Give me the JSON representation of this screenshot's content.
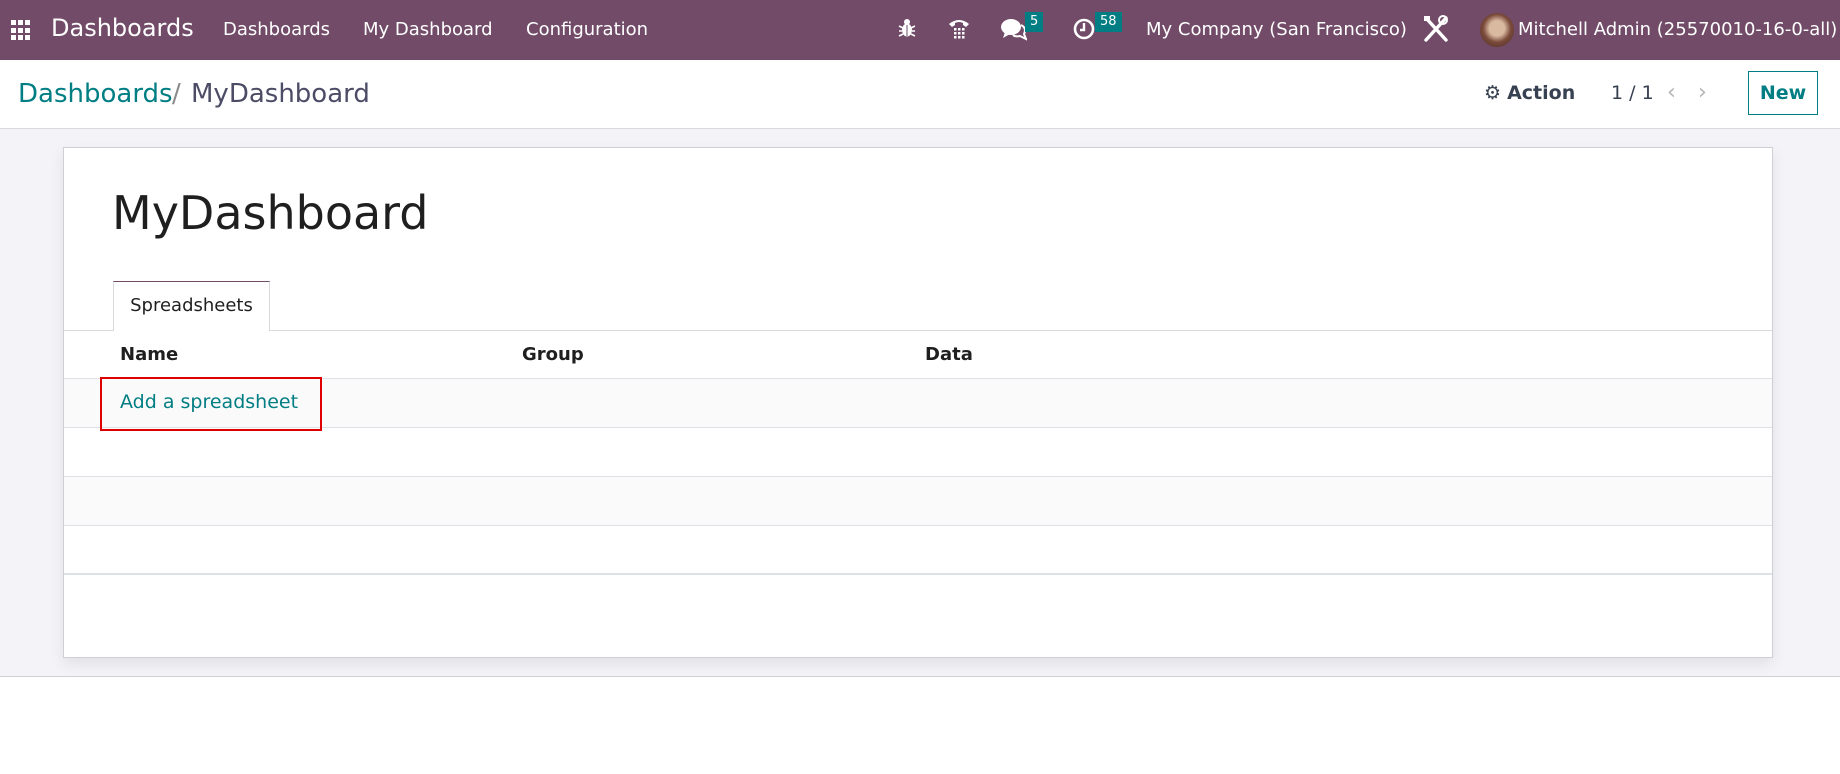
{
  "navbar": {
    "app_name": "Dashboards",
    "menu": [
      "Dashboards",
      "My Dashboard",
      "Configuration"
    ],
    "icons": {
      "apps": "apps-grid-icon",
      "debug": "bug-icon",
      "phone": "phone-icon",
      "messages": "chat-icon",
      "activities": "clock-icon",
      "settings": "tools-icon"
    },
    "messages_count": "5",
    "activities_count": "58",
    "company": "My Company (San Francisco)",
    "user": "Mitchell Admin (25570010-16-0-all)",
    "color": "#714b67"
  },
  "control_panel": {
    "breadcrumb_root": "Dashboards",
    "breadcrumb_sep": "/",
    "breadcrumb_current": "MyDashboard",
    "action_label": "Action",
    "pager": "1 / 1",
    "new_label": "New"
  },
  "form": {
    "title": "MyDashboard",
    "tabs": [
      {
        "label": "Spreadsheets",
        "active": true
      }
    ],
    "table": {
      "columns": [
        "Name",
        "Group",
        "Data"
      ],
      "add_row_label": "Add a spreadsheet",
      "empty_rows": 3
    }
  },
  "colors": {
    "accent": "#017e84",
    "highlight": "#e00000"
  }
}
